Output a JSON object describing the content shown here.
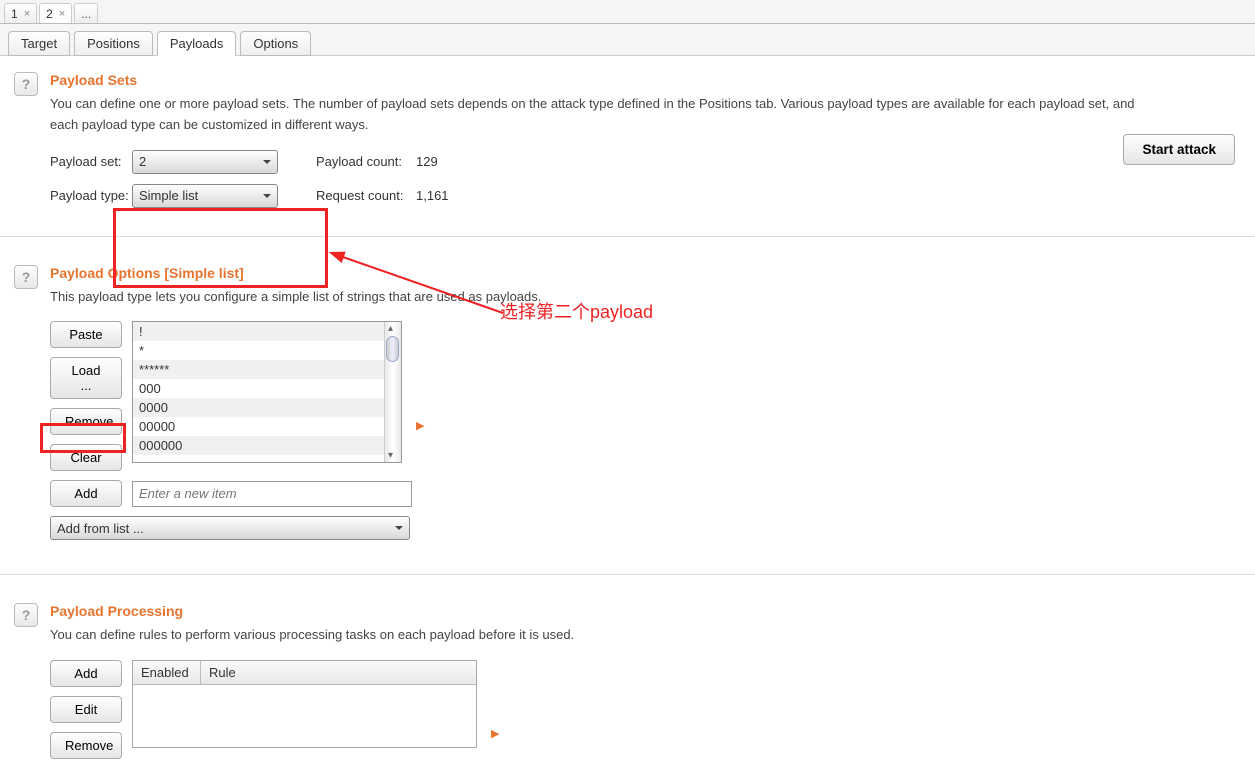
{
  "topTabs": {
    "t1": "1",
    "t2": "2",
    "ell": "..."
  },
  "subTabs": {
    "target": "Target",
    "positions": "Positions",
    "payloads": "Payloads",
    "options": "Options"
  },
  "startAttack": "Start attack",
  "help": "?",
  "sets": {
    "title": "Payload Sets",
    "desc": "You can define one or more payload sets. The number of payload sets depends on the attack type defined in the Positions tab. Various payload types are available for each payload set, and each payload type can be customized in different ways.",
    "setLabel": "Payload set:",
    "setValue": "2",
    "typeLabel": "Payload type:",
    "typeValue": "Simple list",
    "payloadCountLabel": "Payload count:",
    "payloadCountValue": "129",
    "requestCountLabel": "Request count:",
    "requestCountValue": "1,161"
  },
  "annotation": "选择第二个payload",
  "options": {
    "title": "Payload Options [Simple list]",
    "desc": "This payload type lets you configure a simple list of strings that are used as payloads.",
    "paste": "Paste",
    "load": "Load ...",
    "remove": "Remove",
    "clear": "Clear",
    "add": "Add",
    "placeholder": "Enter a new item",
    "addFromList": "Add from list ...",
    "items": [
      "!",
      "*",
      "******",
      "000",
      "0000",
      "00000",
      "000000"
    ]
  },
  "processing": {
    "title": "Payload Processing",
    "desc": "You can define rules to perform various processing tasks on each payload before it is used.",
    "add": "Add",
    "edit": "Edit",
    "remove": "Remove",
    "colEnabled": "Enabled",
    "colRule": "Rule"
  }
}
